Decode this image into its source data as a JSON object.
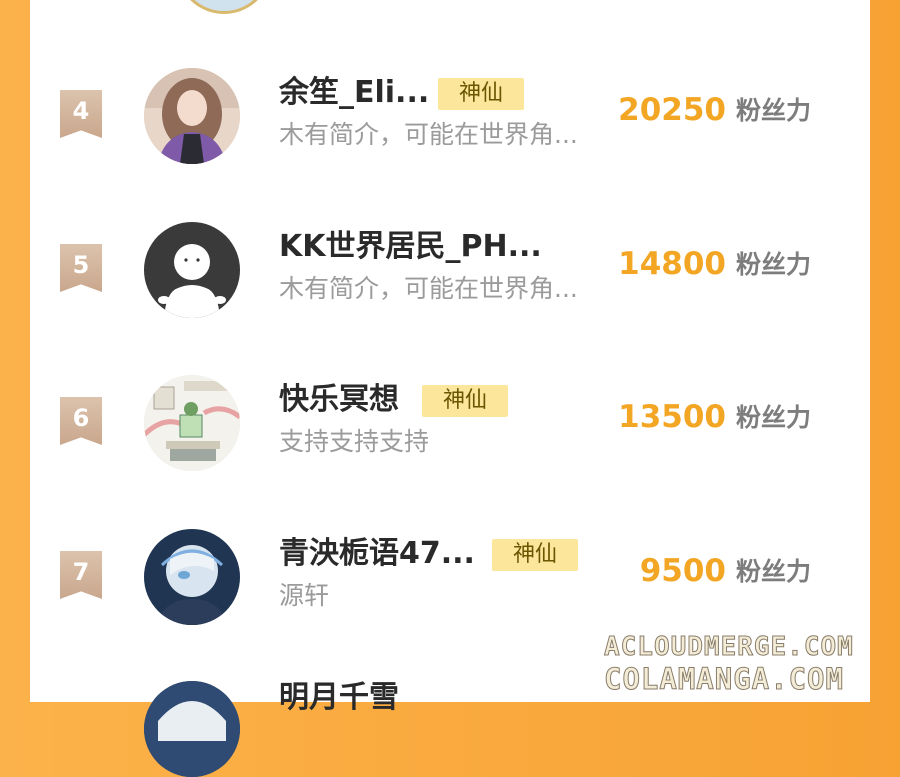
{
  "ranking": {
    "rows": [
      {
        "rank": "4",
        "name": "余笙_Eli...",
        "badge": "神仙",
        "bio": "木有简介，可能在世界角...",
        "score": "20250",
        "unit": "粉丝力"
      },
      {
        "rank": "5",
        "name": "KK世界居民_PH...",
        "badge": "",
        "bio": "木有简介，可能在世界角...",
        "score": "14800",
        "unit": "粉丝力"
      },
      {
        "rank": "6",
        "name": "快乐冥想",
        "badge": "神仙",
        "bio": "支持支持支持",
        "score": "13500",
        "unit": "粉丝力"
      },
      {
        "rank": "7",
        "name": "青泱栀语47...",
        "badge": "神仙",
        "bio": "源轩",
        "score": "9500",
        "unit": "粉丝力"
      }
    ],
    "partial_next_name": "明月千雪"
  },
  "watermark": {
    "line1": "ACLOUDMERGE.COM",
    "line2": "COLAMANGA.COM"
  },
  "colors": {
    "accent_orange": "#f2a623",
    "badge_bg": "#fbe69c",
    "rank_ribbon": "#c9a78d",
    "page_bg": "#f7a233"
  }
}
